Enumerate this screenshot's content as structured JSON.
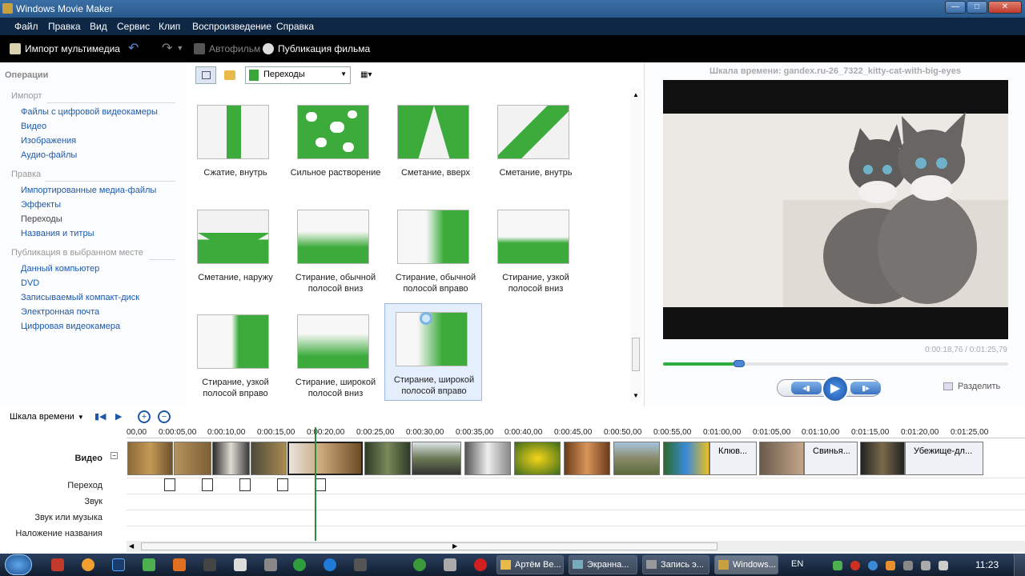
{
  "window": {
    "title": "Windows Movie Maker",
    "min_glyph": "—",
    "max_glyph": "□",
    "close_glyph": "✕"
  },
  "menu": [
    "Файл",
    "Правка",
    "Вид",
    "Сервис",
    "Клип",
    "Воспроизведение",
    "Справка"
  ],
  "toolbar": {
    "import_label": "Импорт мультимедиа",
    "automovie_label": "Автофильм",
    "publish_label": "Публикация фильма"
  },
  "tasks": {
    "header": "Операции",
    "sections": [
      {
        "title": "Импорт",
        "items": [
          "Файлы с цифровой видеокамеры",
          "Видео",
          "Изображения",
          "Аудио-файлы"
        ]
      },
      {
        "title": "Правка",
        "items": [
          "Импортированные медиа-файлы",
          "Эффекты",
          "Переходы",
          "Названия и титры"
        ]
      },
      {
        "title": "Публикация в выбранном месте",
        "items": [
          "Данный компьютер",
          "DVD",
          "Записываемый компакт-диск",
          "Электронная почта",
          "Цифровая видеокамера"
        ]
      }
    ]
  },
  "content": {
    "dropdown_value": "Переходы",
    "transitions": [
      {
        "label": "Сжатие, внутрь"
      },
      {
        "label": "Сильное растворение"
      },
      {
        "label": "Сметание, вверх"
      },
      {
        "label": "Сметание, внутрь"
      },
      {
        "label": "Сметание, наружу"
      },
      {
        "label": "Стирание, обычной полосой вниз"
      },
      {
        "label": "Стирание, обычной полосой вправо"
      },
      {
        "label": "Стирание, узкой полосой вниз"
      },
      {
        "label": "Стирание, узкой полосой вправо"
      },
      {
        "label": "Стирание, широкой полосой вниз"
      },
      {
        "label": "Стирание, широкой полосой вправо"
      }
    ]
  },
  "preview": {
    "title": "Шкала времени: gandex.ru-26_7322_kitty-cat-with-big-eyes",
    "time": "0:00:18,76 / 0:01:25,79",
    "progress": 0.22,
    "split_label": "Разделить"
  },
  "timeline": {
    "mode_label": "Шкала времени",
    "ruler": [
      "00,00",
      "0:00:05,00",
      "0:00:10,00",
      "0:00:15,00",
      "0:00:20,00",
      "0:00:25,00",
      "0:00:30,00",
      "0:00:35,00",
      "0:00:40,00",
      "0:00:45,00",
      "0:00:50,00",
      "0:00:55,00",
      "0:01:00,00",
      "0:01:05,00",
      "0:01:10,00",
      "0:01:15,00",
      "0:01:20,00",
      "0:01:25,00"
    ],
    "tracks": {
      "video": "Видео",
      "transition": "Переход",
      "audio": "Звук",
      "music": "Звук или музыка",
      "title_overlay": "Наложение названия"
    },
    "clip_labels": [
      "Клюв...",
      "Свинья...",
      "Убежище-дл..."
    ]
  },
  "taskbar": {
    "apps": [
      "Артём Ве...",
      "Экранна...",
      "Запись э...",
      "Windows..."
    ],
    "lang": "EN",
    "clock": "11:23"
  }
}
